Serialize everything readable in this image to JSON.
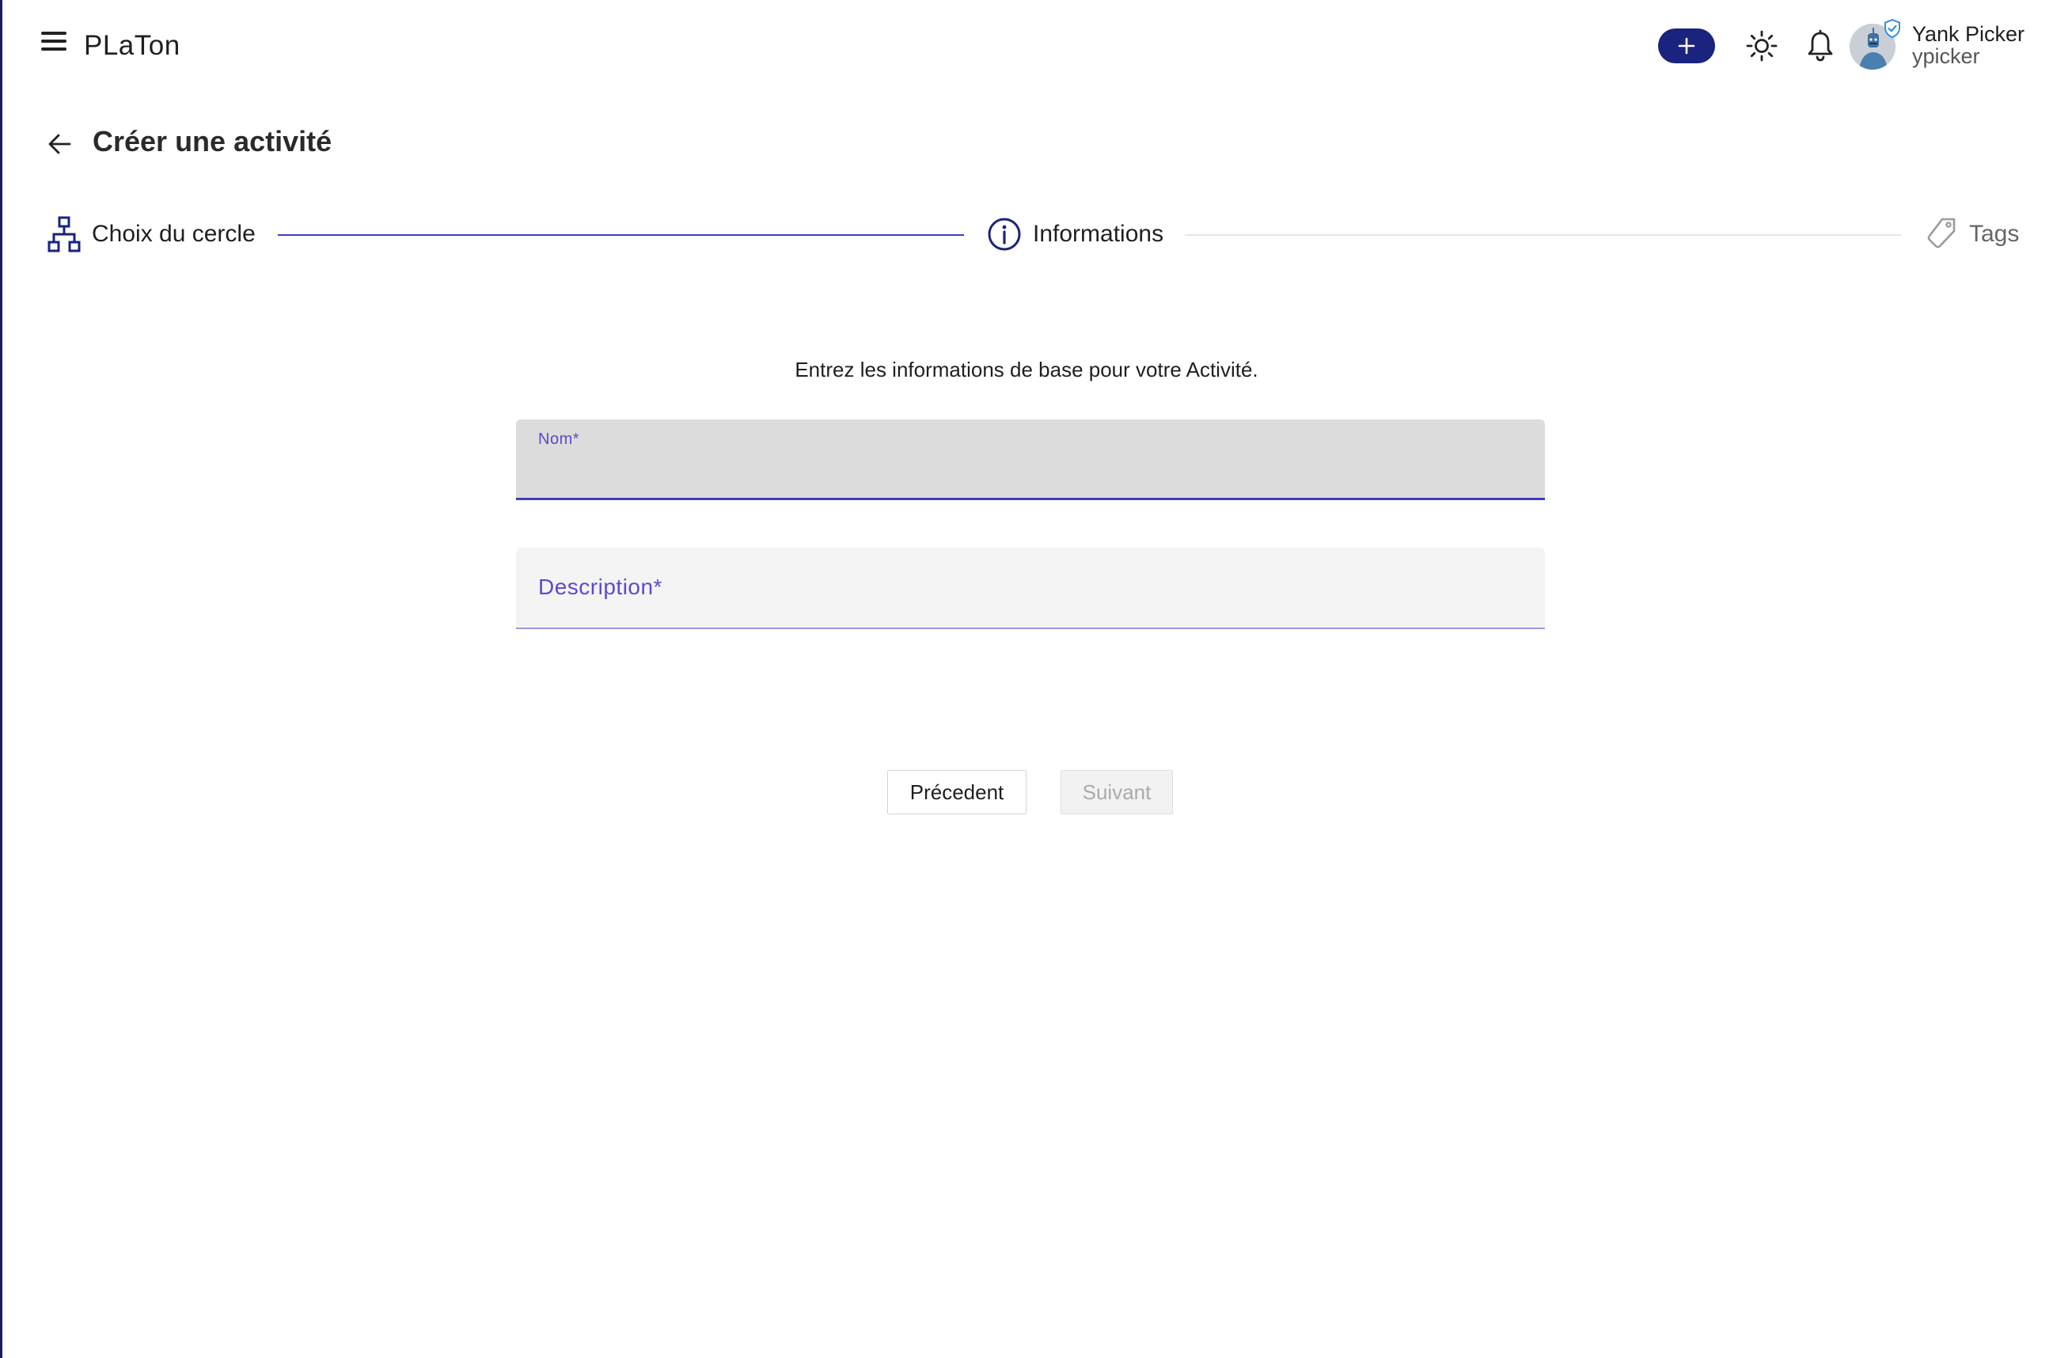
{
  "header": {
    "app_title": "PLaTon",
    "add_icon": "plus-icon",
    "theme_icon": "sun-icon",
    "notifications_icon": "bell-icon",
    "user": {
      "name": "Yank Picker",
      "handle": "ypicker"
    }
  },
  "page": {
    "title": "Créer une activité",
    "back_icon": "arrow-left-icon"
  },
  "stepper": {
    "steps": [
      {
        "label": "Choix du cercle",
        "icon": "hierarchy-icon",
        "state": "completed"
      },
      {
        "label": "Informations",
        "icon": "info-circle-icon",
        "state": "active"
      },
      {
        "label": "Tags",
        "icon": "tag-icon",
        "state": "pending"
      }
    ]
  },
  "form": {
    "intro": "Entrez les informations de base pour votre Activité.",
    "name_label": "Nom*",
    "description_label": "Description*",
    "prev_label": "Précedent",
    "next_label": "Suivant"
  },
  "colors": {
    "accent": "#1a237e",
    "field_label": "#5a4ad1",
    "step_line_active": "#3d3dc4",
    "step_line_inactive": "#e6e6e6"
  }
}
